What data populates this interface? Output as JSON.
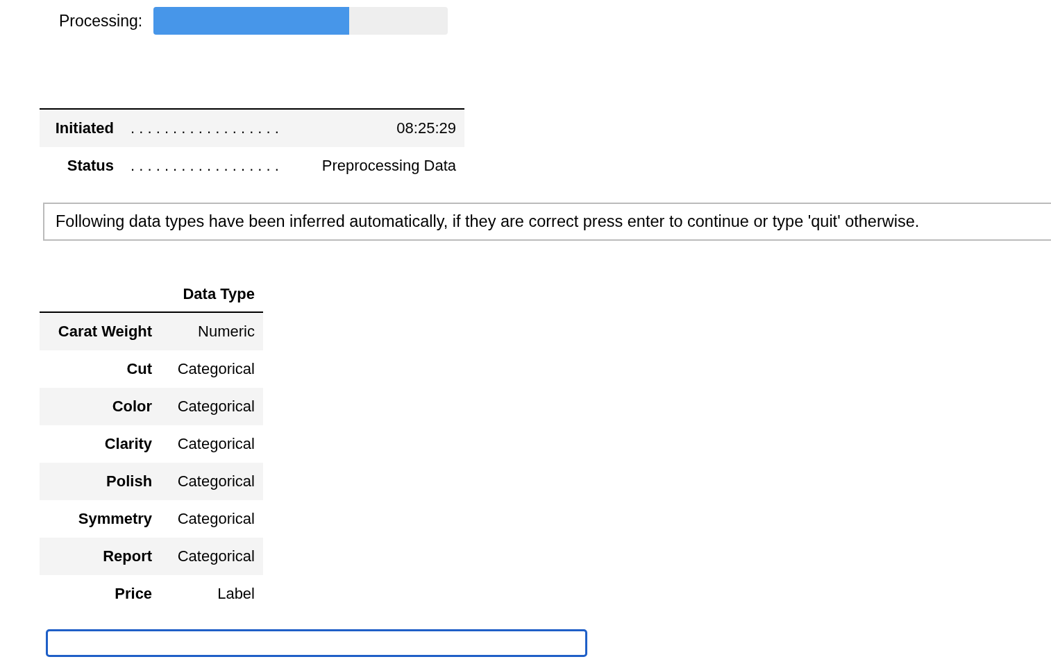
{
  "progress": {
    "label": "Processing:",
    "level": 0.665
  },
  "info_table": {
    "rows": [
      {
        "label": "Initiated",
        "leader": ". . . . . . . . . . . . . . . . . .",
        "value": "08:25:29"
      },
      {
        "label": "Status",
        "leader": ". . . . . . . . . . . . . . . . . .",
        "value": "Preprocessing Data"
      }
    ]
  },
  "notice": "Following data types have been inferred automatically, if they are correct press enter to continue or type 'quit' otherwise.",
  "types_table": {
    "columns": [
      "Data Type"
    ],
    "rows": [
      {
        "feature": "Carat Weight",
        "type": "Numeric"
      },
      {
        "feature": "Cut",
        "type": "Categorical"
      },
      {
        "feature": "Color",
        "type": "Categorical"
      },
      {
        "feature": "Clarity",
        "type": "Categorical"
      },
      {
        "feature": "Polish",
        "type": "Categorical"
      },
      {
        "feature": "Symmetry",
        "type": "Categorical"
      },
      {
        "feature": "Report",
        "type": "Categorical"
      },
      {
        "feature": "Price",
        "type": "Label"
      }
    ]
  },
  "input": {
    "focused": true
  }
}
